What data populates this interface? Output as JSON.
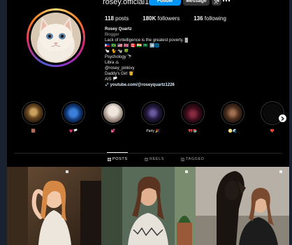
{
  "profile": {
    "username": "rosey.official1",
    "follow_label": "Follow",
    "message_label": "Message",
    "suggest_icon": "add-person-icon",
    "more_icon": "more-dots-icon"
  },
  "stats": {
    "posts_count": "118",
    "posts_label": "posts",
    "followers_count": "180K",
    "followers_label": "followers",
    "following_count": "136",
    "following_label": "following"
  },
  "bio": {
    "name": "Rosey Quartz",
    "category": "Blogger",
    "lines": [
      "Lack of intelligence is the greatest poverty. ▓",
      "🇵🇭 🇧🇷 🇺🇸 🇬🇧 🇨🇦 🇮🇳 🇸🇦 ➡️🌐",
      "🦙 🐈 🐄 🍀",
      "Psychology 🔭",
      "Libra ♎",
      "@rosey_pinkivy",
      "Daddy's Girl 👸",
      "AIS 🏳️",
      "youtube.com/@roseyquartz1226"
    ]
  },
  "highlights": [
    {
      "label": "🟫",
      "color_a": "#8a6a3a",
      "color_b": "#2b1d0e"
    },
    {
      "label": "💗🏳️",
      "color_a": "#1e4a8a",
      "color_b": "#050c1c"
    },
    {
      "label": "💕",
      "color_a": "#d8cfc6",
      "color_b": "#6b5a50"
    },
    {
      "label": "Party 🎉",
      "color_a": "#3b2d5c",
      "color_b": "#0a0714"
    },
    {
      "label": "🎀📚",
      "color_a": "#4a1a2a",
      "color_b": "#120408"
    },
    {
      "label": "🌝🌊",
      "color_a": "#5a3a2a",
      "color_b": "#1a0e08"
    },
    {
      "label": "❤️",
      "color_a": "#101010",
      "color_b": "#050505"
    }
  ],
  "tabs": {
    "posts": "POSTS",
    "reels": "REELS",
    "tagged": "TAGGED"
  },
  "colors": {
    "accent": "#0095f6",
    "background": "#000000",
    "button_secondary": "#363636"
  }
}
